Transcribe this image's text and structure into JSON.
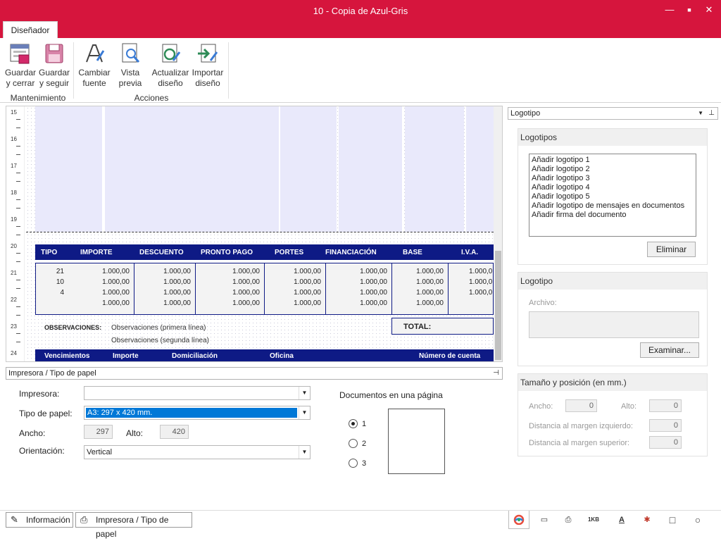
{
  "window": {
    "title": "10 - Copia de Azul-Gris",
    "minimize": "—",
    "maximize": "■",
    "close": "✕"
  },
  "ribbon": {
    "tab": "Diseñador",
    "buttons": {
      "guardar_cerrar": [
        "Guardar",
        "y cerrar"
      ],
      "guardar_seguir": [
        "Guardar",
        "y seguir"
      ],
      "cambiar_fuente": [
        "Cambiar",
        "fuente"
      ],
      "vista_previa": [
        "Vista",
        "previa"
      ],
      "actualizar_diseno": [
        "Actualizar",
        "diseño"
      ],
      "importar_diseno": [
        "Importar",
        "diseño"
      ]
    },
    "groups": {
      "mantenimiento": "Mantenimiento",
      "acciones": "Acciones"
    }
  },
  "ruler": {
    "labels": [
      "15",
      "16",
      "17",
      "18",
      "19",
      "20",
      "21",
      "22",
      "23",
      "24"
    ]
  },
  "document": {
    "headers": [
      "TIPO",
      "IMPORTE",
      "DESCUENTO",
      "PRONTO PAGO",
      "PORTES",
      "FINANCIACIÓN",
      "BASE",
      "I.V.A."
    ],
    "tipos": [
      "21",
      "10",
      "4"
    ],
    "amount": "1.000,00",
    "amount_cut": "1.000,0",
    "observaciones_label": "OBSERVACIONES:",
    "observaciones_1": "Observaciones (primera línea)",
    "observaciones_2": "Observaciones (segunda línea)",
    "total_label": "TOTAL:",
    "footer_headers": [
      "Vencimientos",
      "Importe",
      "Domiciliación",
      "Oficina",
      "Número de cuenta"
    ]
  },
  "printer_panel": {
    "title": "Impresora / Tipo de papel",
    "impresora_label": "Impresora:",
    "impresora_value": "",
    "tipo_papel_label": "Tipo de papel:",
    "tipo_papel_value": "A3: 297 x 420 mm.",
    "ancho_label": "Ancho:",
    "ancho_value": "297",
    "alto_label": "Alto:",
    "alto_value": "420",
    "orientacion_label": "Orientación:",
    "orientacion_value": "Vertical",
    "docs_label": "Documentos en una página",
    "docs_options": [
      "1",
      "2",
      "3"
    ],
    "docs_selected": "1"
  },
  "right_panel": {
    "dropdown": "Logotipo",
    "logotipos_title": "Logotipos",
    "logotipos_items": [
      "Añadir logotipo 1",
      "Añadir logotipo 2",
      "Añadir logotipo 3",
      "Añadir logotipo 4",
      "Añadir logotipo 5",
      "Añadir logotipo de mensajes en documentos",
      "Añadir firma del documento"
    ],
    "eliminar": "Eliminar",
    "logotipo_title": "Logotipo",
    "archivo_label": "Archivo:",
    "examinar": "Examinar...",
    "tamano_title": "Tamaño y posición (en mm.)",
    "ancho_label": "Ancho:",
    "ancho_value": "0",
    "alto_label": "Alto:",
    "alto_value": "0",
    "margen_izq_label": "Distancia al margen izquierdo:",
    "margen_izq_value": "0",
    "margen_sup_label": "Distancia al margen superior:",
    "margen_sup_value": "0"
  },
  "bottom_tabs": [
    "Información",
    "Impresora / Tipo de papel"
  ],
  "bottom_icons": [
    "palette-icon",
    "insert-icon",
    "printer-icon",
    "barcode-icon",
    "text-icon",
    "line-icon",
    "rectangle-icon",
    "ellipse-icon"
  ],
  "bottom_icon_labels": {
    "barcode": "1KB"
  },
  "colors": {
    "titlebar": "#d6153d",
    "doc_header": "#0e1a85",
    "cell_fill": "#e9e9fb",
    "selection": "#0078d7"
  }
}
